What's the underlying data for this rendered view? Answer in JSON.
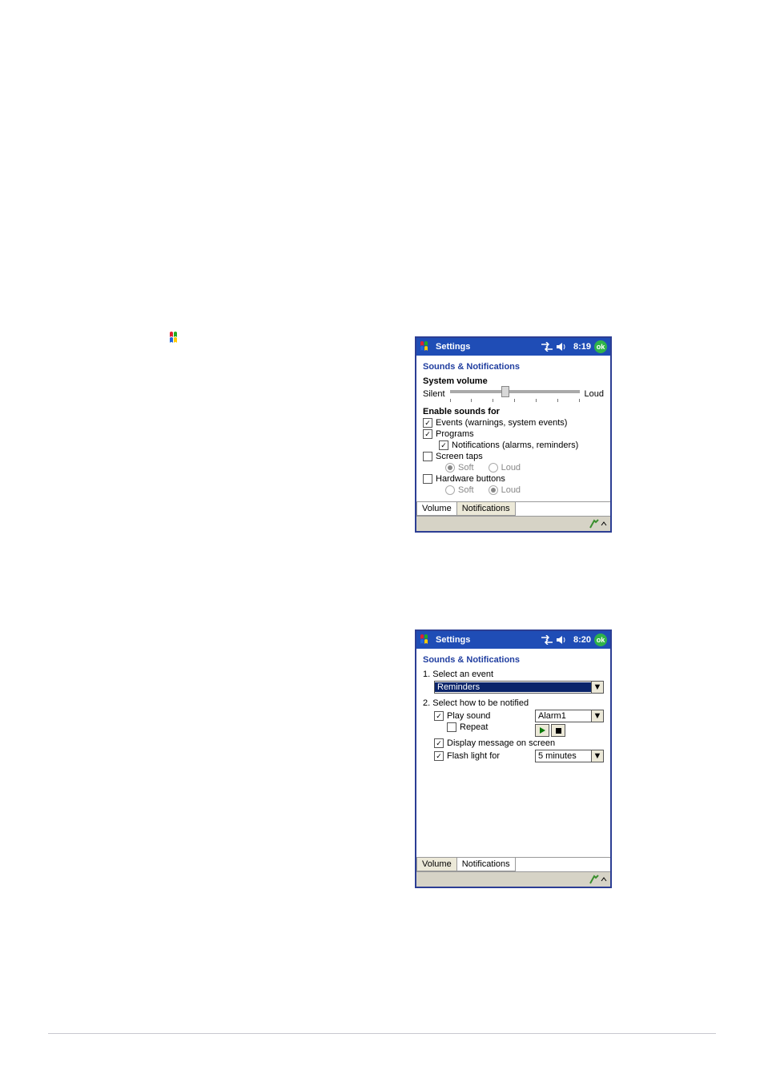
{
  "inline_start_icon_name": "windows-start-icon",
  "pda1": {
    "titlebar": {
      "title": "Settings",
      "time": "8:19",
      "ok": "ok"
    },
    "heading": "Sounds & Notifications",
    "system_volume_label": "System volume",
    "silent": "Silent",
    "loud": "Loud",
    "slider_value_percent": 40,
    "enable_sounds_label": "Enable sounds for",
    "events_label": "Events (warnings, system events)",
    "events_checked": true,
    "programs_label": "Programs",
    "programs_checked": true,
    "notifications_sub_label": "Notifications (alarms, reminders)",
    "notifications_sub_checked": true,
    "screen_taps_label": "Screen taps",
    "screen_taps_checked": false,
    "screen_taps_soft": "Soft",
    "screen_taps_loud": "Loud",
    "screen_taps_selected": "soft",
    "hw_buttons_label": "Hardware buttons",
    "hw_buttons_checked": false,
    "hw_buttons_soft": "Soft",
    "hw_buttons_loud": "Loud",
    "hw_buttons_selected": "loud",
    "tabs": {
      "volume": "Volume",
      "notifications": "Notifications",
      "active": "volume"
    }
  },
  "pda2": {
    "titlebar": {
      "title": "Settings",
      "time": "8:20",
      "ok": "ok"
    },
    "heading": "Sounds & Notifications",
    "step1_label": "1. Select an event",
    "event_dropdown_value": "Reminders",
    "step2_label": "2. Select how to be notified",
    "play_sound_label": "Play sound",
    "play_sound_checked": true,
    "sound_dropdown_value": "Alarm1",
    "repeat_label": "Repeat",
    "repeat_checked": false,
    "display_msg_label": "Display message on screen",
    "display_msg_checked": true,
    "flash_light_label": "Flash light for",
    "flash_light_checked": true,
    "flash_dropdown_value": "5 minutes",
    "tabs": {
      "volume": "Volume",
      "notifications": "Notifications",
      "active": "notifications"
    }
  }
}
